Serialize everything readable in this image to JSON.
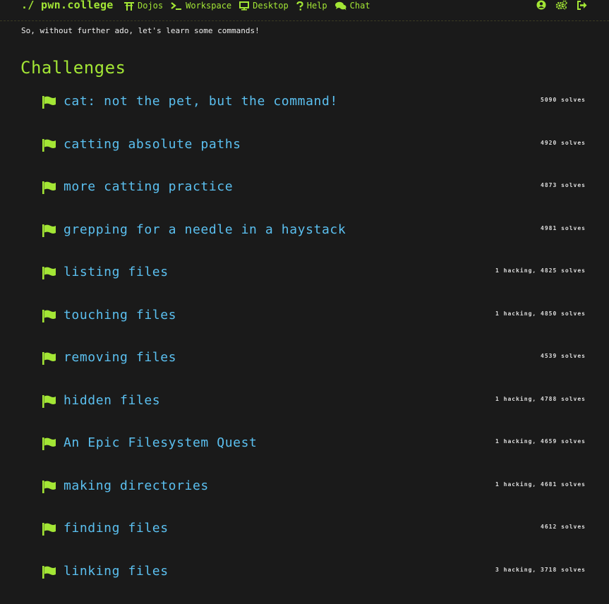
{
  "brand": "./ pwn.college",
  "nav": {
    "dojos": "Dojos",
    "workspace": "Workspace",
    "desktop": "Desktop",
    "help": "Help",
    "chat": "Chat"
  },
  "icons": {
    "dojos": "torii-gate-icon",
    "workspace": "terminal-icon",
    "desktop": "monitor-icon",
    "help": "question-icon",
    "chat": "chat-bubbles-icon",
    "account": "user-circle-icon",
    "settings": "gears-icon",
    "logout": "sign-out-icon",
    "challenge": "flag-icon"
  },
  "colors": {
    "accent": "#a3e635",
    "link": "#5bc0f0",
    "background": "#1a1a1a"
  },
  "intro_text": "So, without further ado, let's learn some commands!",
  "section_title": "Challenges",
  "challenges": [
    {
      "name": "cat: not the pet, but the command!",
      "meta": "5090 solves"
    },
    {
      "name": "catting absolute paths",
      "meta": "4920 solves"
    },
    {
      "name": "more catting practice",
      "meta": "4873 solves"
    },
    {
      "name": "grepping for a needle in a haystack",
      "meta": "4981 solves"
    },
    {
      "name": "listing files",
      "meta": "1 hacking, 4825 solves"
    },
    {
      "name": "touching files",
      "meta": "1 hacking, 4850 solves"
    },
    {
      "name": "removing files",
      "meta": "4539 solves"
    },
    {
      "name": "hidden files",
      "meta": "1 hacking, 4788 solves"
    },
    {
      "name": "An Epic Filesystem Quest",
      "meta": "1 hacking, 4659 solves"
    },
    {
      "name": "making directories",
      "meta": "1 hacking, 4681 solves"
    },
    {
      "name": "finding files",
      "meta": "4612 solves"
    },
    {
      "name": "linking files",
      "meta": "3 hacking, 3718 solves"
    }
  ]
}
